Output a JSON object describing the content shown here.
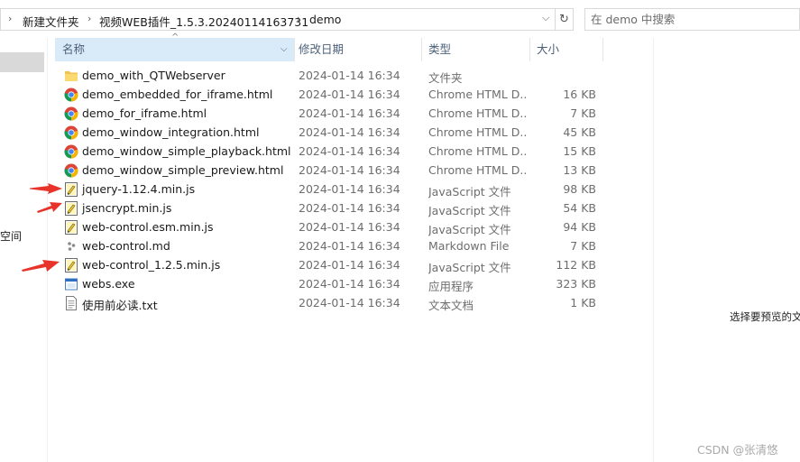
{
  "breadcrumb": {
    "items": [
      "新建文件夹",
      "视频WEB插件_1.5.3.20240114163731",
      "demo"
    ]
  },
  "search": {
    "placeholder": "在 demo 中搜索"
  },
  "nav": {
    "partial_label": "空间"
  },
  "columns": {
    "name": "名称",
    "date": "修改日期",
    "type": "类型",
    "size": "大小"
  },
  "files": [
    {
      "name": "demo_with_QTWebserver",
      "date": "2024-01-14 16:34",
      "type": "文件夹",
      "size": "",
      "icon": "folder-icon"
    },
    {
      "name": "demo_embedded_for_iframe.html",
      "date": "2024-01-14 16:34",
      "type": "Chrome HTML D...",
      "size": "16 KB",
      "icon": "chrome-html-icon"
    },
    {
      "name": "demo_for_iframe.html",
      "date": "2024-01-14 16:34",
      "type": "Chrome HTML D...",
      "size": "7 KB",
      "icon": "chrome-html-icon"
    },
    {
      "name": "demo_window_integration.html",
      "date": "2024-01-14 16:34",
      "type": "Chrome HTML D...",
      "size": "45 KB",
      "icon": "chrome-html-icon"
    },
    {
      "name": "demo_window_simple_playback.html",
      "date": "2024-01-14 16:34",
      "type": "Chrome HTML D...",
      "size": "15 KB",
      "icon": "chrome-html-icon"
    },
    {
      "name": "demo_window_simple_preview.html",
      "date": "2024-01-14 16:34",
      "type": "Chrome HTML D...",
      "size": "13 KB",
      "icon": "chrome-html-icon"
    },
    {
      "name": "jquery-1.12.4.min.js",
      "date": "2024-01-14 16:34",
      "type": "JavaScript 文件",
      "size": "98 KB",
      "icon": "javascript-file-icon"
    },
    {
      "name": "jsencrypt.min.js",
      "date": "2024-01-14 16:34",
      "type": "JavaScript 文件",
      "size": "54 KB",
      "icon": "javascript-file-icon"
    },
    {
      "name": "web-control.esm.min.js",
      "date": "2024-01-14 16:34",
      "type": "JavaScript 文件",
      "size": "94 KB",
      "icon": "javascript-file-icon"
    },
    {
      "name": "web-control.md",
      "date": "2024-01-14 16:34",
      "type": "Markdown File",
      "size": "7 KB",
      "icon": "markdown-file-icon"
    },
    {
      "name": "web-control_1.2.5.min.js",
      "date": "2024-01-14 16:34",
      "type": "JavaScript 文件",
      "size": "112 KB",
      "icon": "javascript-file-icon"
    },
    {
      "name": "webs.exe",
      "date": "2024-01-14 16:34",
      "type": "应用程序",
      "size": "323 KB",
      "icon": "exe-file-icon"
    },
    {
      "name": "使用前必读.txt",
      "date": "2024-01-14 16:34",
      "type": "文本文档",
      "size": "1 KB",
      "icon": "text-file-icon"
    }
  ],
  "preview": {
    "message": "选择要预览的文"
  },
  "watermark": "CSDN @张清悠",
  "colors": {
    "accent_header": "#d9ebf9",
    "annotation_arrow": "#e8332a"
  }
}
